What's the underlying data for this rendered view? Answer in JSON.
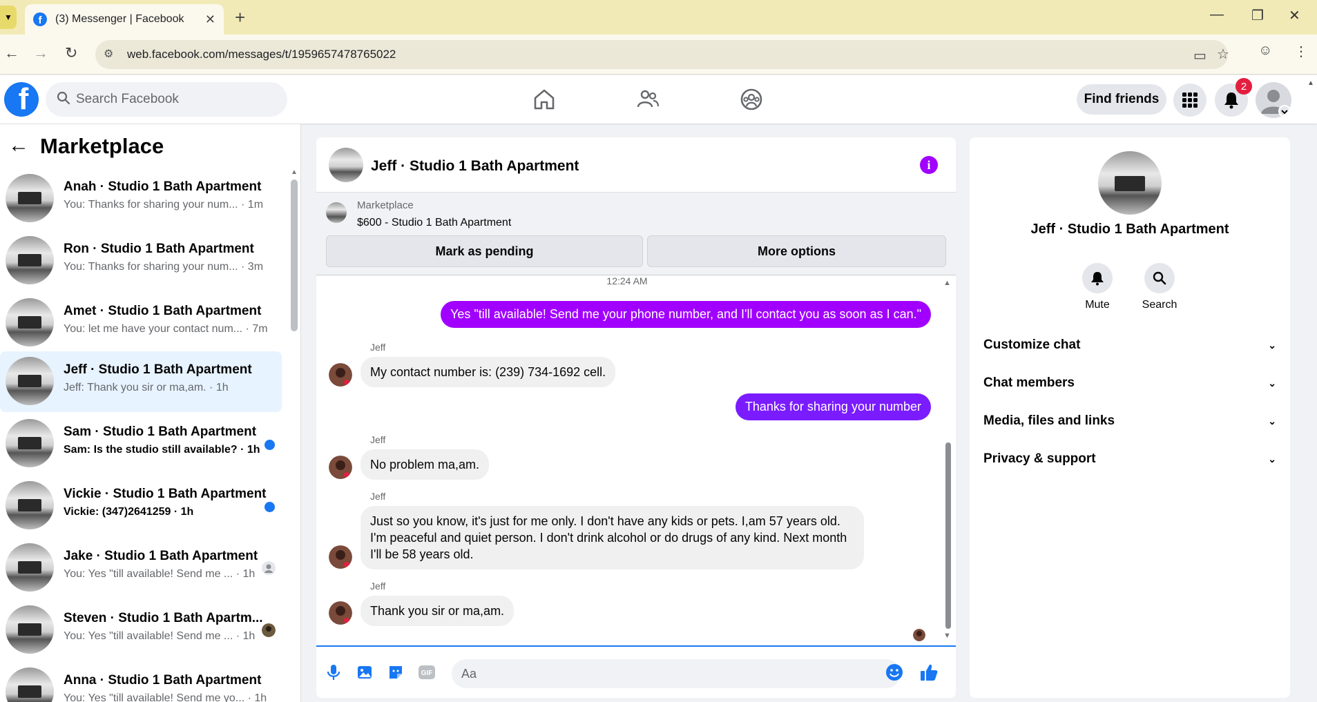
{
  "browser": {
    "tab_title": "(3) Messenger | Facebook",
    "url": "web.facebook.com/messages/t/1959657478765022"
  },
  "fb": {
    "search_placeholder": "Search Facebook",
    "find_friends": "Find friends",
    "notification_count": "2",
    "brand_color": "#1877f2"
  },
  "sidebar": {
    "title": "Marketplace",
    "conversations": [
      {
        "name": "Anah · Studio 1 Bath Apartment",
        "preview": "You: Thanks for sharing your num... · 1m",
        "unread": false
      },
      {
        "name": "Ron · Studio 1 Bath Apartment",
        "preview": "You: Thanks for sharing your num... · 3m",
        "unread": false
      },
      {
        "name": "Amet · Studio 1 Bath Apartment",
        "preview": "You: let me have your contact num... · 7m",
        "unread": false
      },
      {
        "name": "Jeff · Studio 1 Bath Apartment",
        "preview": "Jeff: Thank you sir or ma,am. · 1h",
        "unread": false,
        "active": true
      },
      {
        "name": "Sam · Studio 1 Bath Apartment",
        "preview": "Sam: Is the studio still available? · 1h",
        "unread": true
      },
      {
        "name": "Vickie · Studio 1 Bath Apartment",
        "preview": "Vickie: (347)2641259 · 1h",
        "unread": true
      },
      {
        "name": "Jake · Studio 1 Bath Apartment",
        "preview": "You: Yes \"till available! Send me ... · 1h",
        "unread": false
      },
      {
        "name": "Steven · Studio 1 Bath Apartm...",
        "preview": "You: Yes \"till available! Send me ... · 1h",
        "unread": false
      },
      {
        "name": "Anna · Studio 1 Bath Apartment",
        "preview": "You: Yes \"till available! Send me yo... · 1h",
        "unread": false
      }
    ]
  },
  "chat": {
    "title": "Jeff · Studio 1 Bath Apartment",
    "marketplace_label": "Marketplace",
    "listing": "$600 - Studio 1 Bath Apartment",
    "mark_pending": "Mark as pending",
    "more_options": "More options",
    "timestamp": "12:24 AM",
    "accent_color": "#a100ff",
    "messages": {
      "out_1": "Yes \"till available! Send me your phone number, and I'll contact you as soon as I can.\"",
      "sender_1": "Jeff",
      "in_1": "My contact number is: (239) 734-1692 cell.",
      "out_2": "Thanks for sharing your number",
      "sender_2": "Jeff",
      "in_2": "No problem ma,am.",
      "sender_3": "Jeff",
      "in_3": "Just so you know, it's just for me only. I don't have any kids or pets. I,am 57 years old. I'm peaceful and quiet person. I don't drink alcohol or do drugs of any kind. Next month I'll be 58 years old.",
      "sender_4": "Jeff",
      "in_4": "Thank you sir or ma,am."
    },
    "composer_placeholder": "Aa"
  },
  "info_panel": {
    "name": "Jeff · Studio 1 Bath Apartment",
    "mute": "Mute",
    "search": "Search",
    "sections": [
      "Customize chat",
      "Chat members",
      "Media, files and links",
      "Privacy & support"
    ]
  }
}
